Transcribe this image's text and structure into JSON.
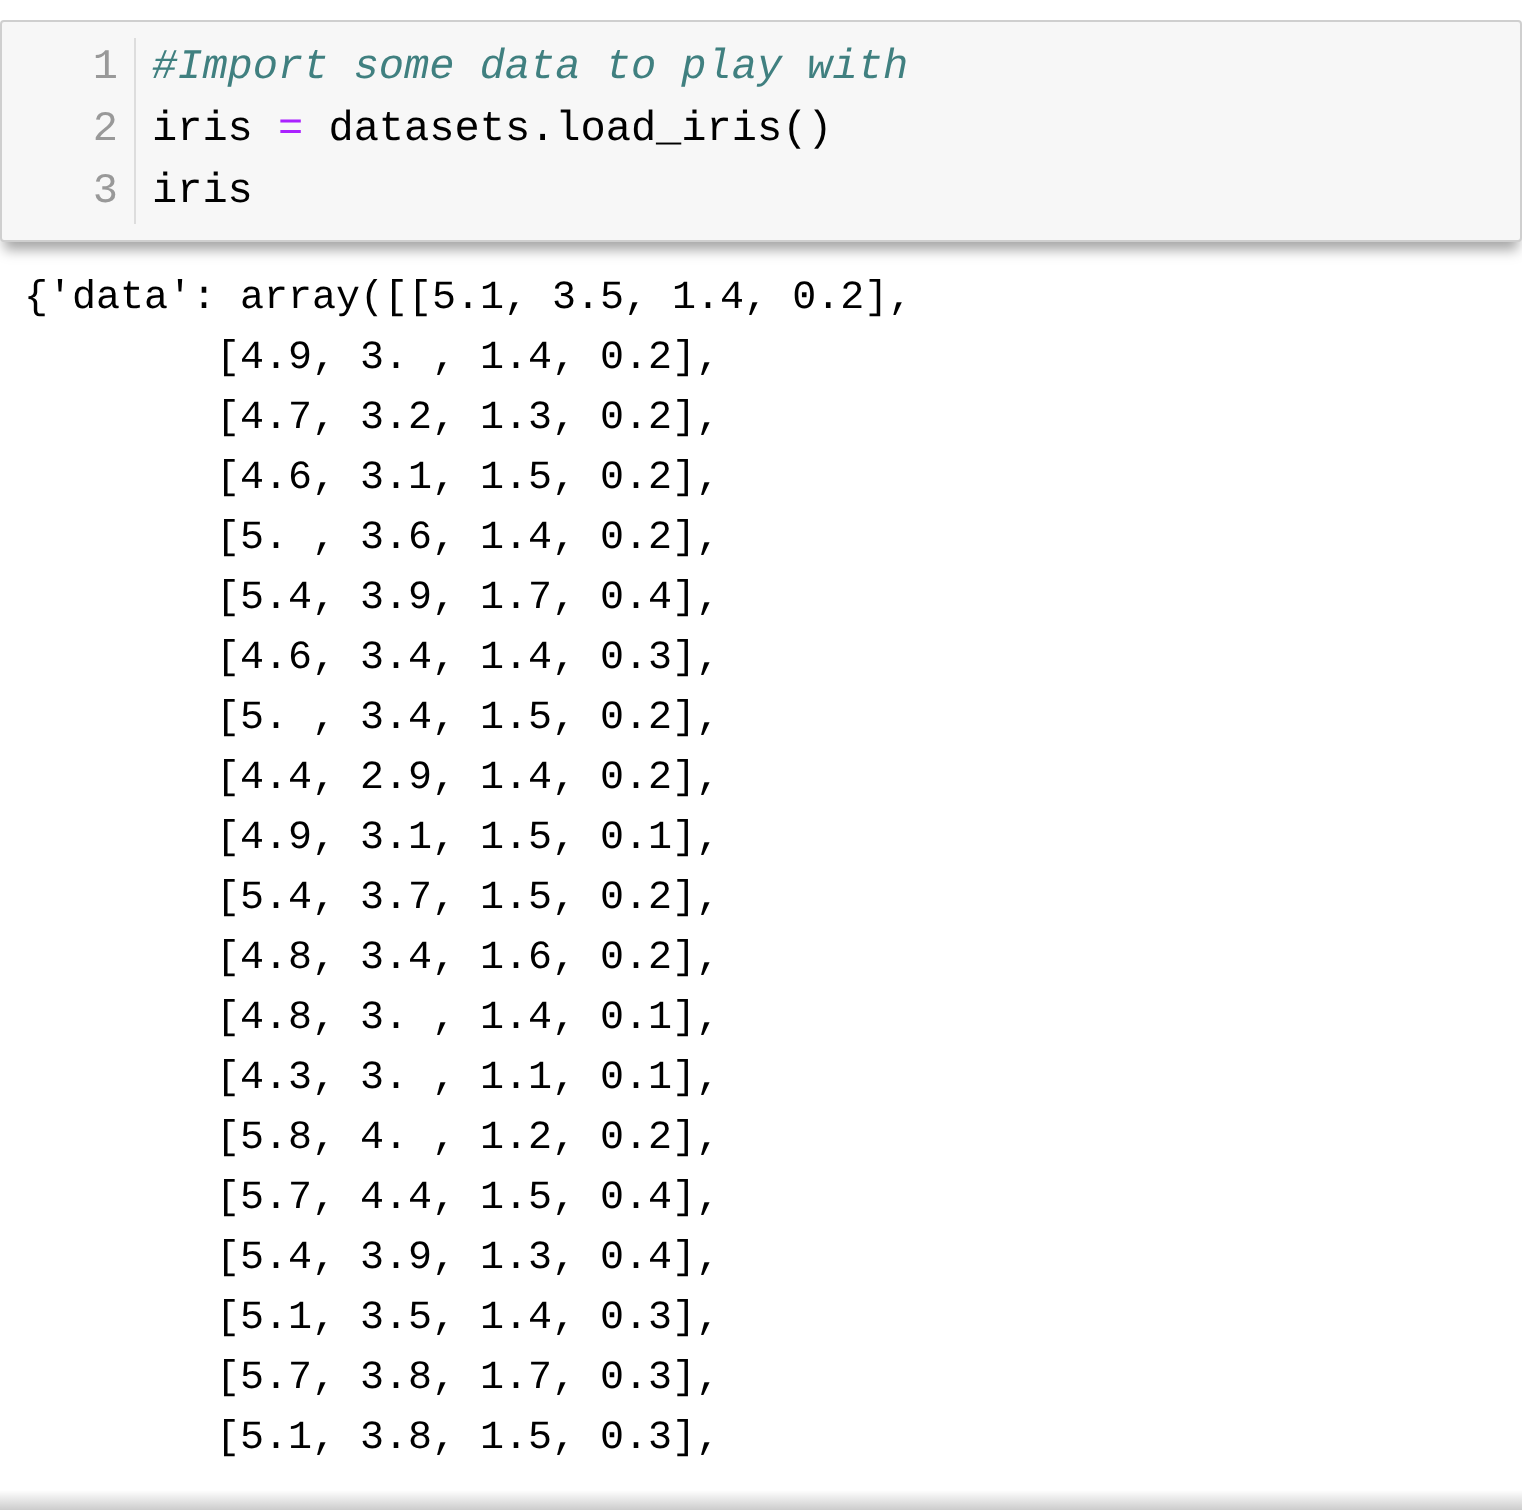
{
  "input_cell": {
    "lines": [
      {
        "number": "1",
        "tokens": [
          {
            "kind": "comment",
            "text": "#Import some data to play with"
          }
        ]
      },
      {
        "number": "2",
        "tokens": [
          {
            "kind": "plain",
            "text": "iris "
          },
          {
            "kind": "operator",
            "text": "="
          },
          {
            "kind": "plain",
            "text": " datasets.load_iris()"
          }
        ]
      },
      {
        "number": "3",
        "tokens": [
          {
            "kind": "plain",
            "text": "iris"
          }
        ]
      }
    ]
  },
  "output": {
    "lines": [
      "{'data': array([[5.1, 3.5, 1.4, 0.2],",
      "        [4.9, 3. , 1.4, 0.2],",
      "        [4.7, 3.2, 1.3, 0.2],",
      "        [4.6, 3.1, 1.5, 0.2],",
      "        [5. , 3.6, 1.4, 0.2],",
      "        [5.4, 3.9, 1.7, 0.4],",
      "        [4.6, 3.4, 1.4, 0.3],",
      "        [5. , 3.4, 1.5, 0.2],",
      "        [4.4, 2.9, 1.4, 0.2],",
      "        [4.9, 3.1, 1.5, 0.1],",
      "        [5.4, 3.7, 1.5, 0.2],",
      "        [4.8, 3.4, 1.6, 0.2],",
      "        [4.8, 3. , 1.4, 0.1],",
      "        [4.3, 3. , 1.1, 0.1],",
      "        [5.8, 4. , 1.2, 0.2],",
      "        [5.7, 4.4, 1.5, 0.4],",
      "        [5.4, 3.9, 1.3, 0.4],",
      "        [5.1, 3.5, 1.4, 0.3],",
      "        [5.7, 3.8, 1.7, 0.3],",
      "        [5.1, 3.8, 1.5, 0.3],"
    ]
  }
}
